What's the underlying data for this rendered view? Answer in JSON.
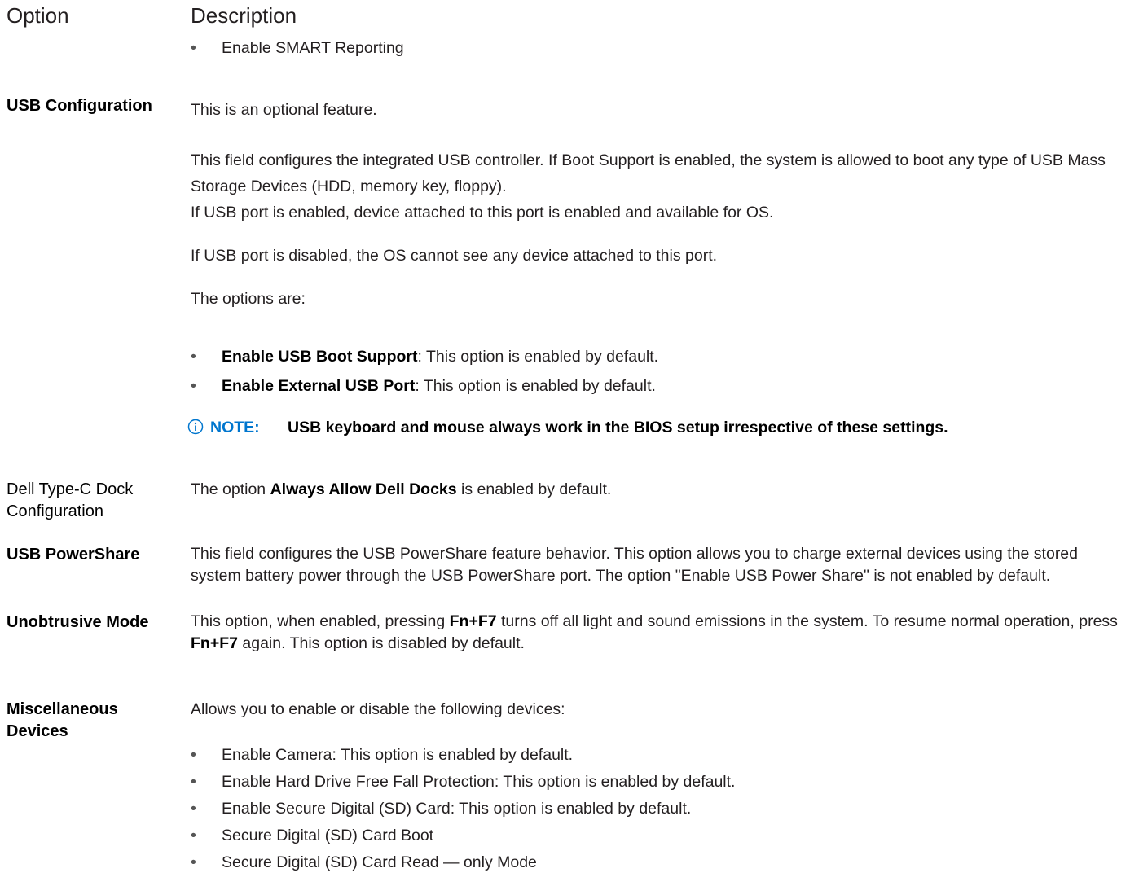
{
  "header": {
    "option": "Option",
    "description": "Description"
  },
  "top_bullet": "Enable SMART Reporting",
  "usb_config": {
    "name": "USB Configuration",
    "p1": "This is an optional feature.",
    "p2": "This field configures the integrated USB controller. If Boot Support is enabled, the system is allowed to boot any type of USB Mass Storage Devices (HDD, memory key, floppy).",
    "p3": "If USB port is enabled, device attached to this port is enabled and available for OS.",
    "p4": "If USB port is disabled, the OS cannot see any device attached to this port.",
    "p5": "The options are:",
    "b1_bold": "Enable USB Boot Support",
    "b1_rest": ": This option is enabled by default.",
    "b2_bold": "Enable External USB Port",
    "b2_rest": ": This option is enabled by default.",
    "note_label": "NOTE:",
    "note_text": "USB keyboard and mouse always work in the BIOS setup irrespective of these settings."
  },
  "dock": {
    "name_line1": "Dell Type-C Dock",
    "name_line2": "Configuration",
    "pre": "The option ",
    "bold": "Always Allow Dell Docks",
    "post": " is enabled by default."
  },
  "powershare": {
    "name": "USB PowerShare",
    "text": "This field configures the USB PowerShare feature behavior. This option allows you to charge external devices using the stored system battery power through the USB PowerShare port. The option \"Enable USB Power Share\" is not enabled by default."
  },
  "unobtrusive": {
    "name": "Unobtrusive Mode",
    "t1": "This option, when enabled, pressing ",
    "k1": "Fn+F7",
    "t2": " turns off all light and sound emissions in the system. To resume normal operation, press ",
    "k2": "Fn+F7",
    "t3": " again. This option is disabled by default."
  },
  "misc": {
    "name_line1": "Miscellaneous",
    "name_line2": "Devices",
    "intro": "Allows you to enable or disable the following devices:",
    "items": [
      "Enable Camera: This option is enabled by default.",
      "Enable Hard Drive Free Fall Protection: This option is enabled by default.",
      "Enable Secure Digital (SD) Card: This option is enabled by default.",
      "Secure Digital (SD) Card Boot",
      "Secure Digital (SD) Card Read — only Mode"
    ]
  }
}
